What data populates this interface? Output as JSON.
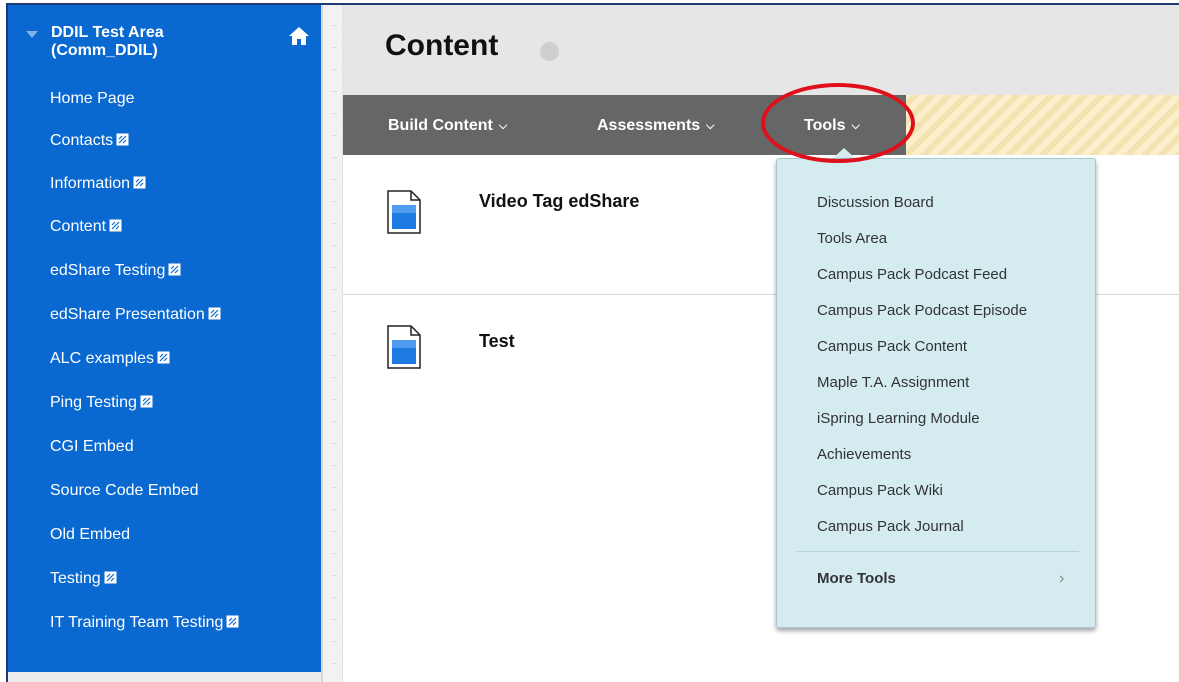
{
  "sidebar": {
    "course_title": "DDIL Test Area (Comm_DDIL)",
    "items": [
      {
        "label": "Home Page",
        "hidden_icon": false
      },
      {
        "label": "Contacts",
        "hidden_icon": true
      },
      {
        "label": "Information",
        "hidden_icon": true
      },
      {
        "label": "Content",
        "hidden_icon": true
      },
      {
        "label": "edShare Testing",
        "hidden_icon": true
      },
      {
        "label": "edShare Presentation",
        "hidden_icon": true
      },
      {
        "label": "ALC examples",
        "hidden_icon": true
      },
      {
        "label": "Ping Testing",
        "hidden_icon": true
      },
      {
        "label": "CGI Embed",
        "hidden_icon": false
      },
      {
        "label": "Source Code Embed",
        "hidden_icon": false
      },
      {
        "label": "Old Embed",
        "hidden_icon": false
      },
      {
        "label": "Testing",
        "hidden_icon": true
      },
      {
        "label": "IT Training Team Testing",
        "hidden_icon": true
      }
    ]
  },
  "page": {
    "title": "Content"
  },
  "action_bar": {
    "build_content": "Build Content",
    "assessments": "Assessments",
    "tools": "Tools"
  },
  "content_items": [
    {
      "title": "Video Tag edShare"
    },
    {
      "title": "Test"
    }
  ],
  "tools_menu": {
    "items": [
      "Discussion Board",
      "Tools Area",
      "Campus Pack Podcast Feed",
      "Campus Pack Podcast Episode",
      "Campus Pack Content",
      "Maple T.A. Assignment",
      "iSpring Learning Module",
      "Achievements",
      "Campus Pack Wiki",
      "Campus Pack Journal"
    ],
    "more_tools": "More Tools"
  },
  "colors": {
    "sidebar": "#0a69d0",
    "action_bar": "#666666",
    "dropdown": "#d4ebf0",
    "highlight": "#e0101a"
  }
}
